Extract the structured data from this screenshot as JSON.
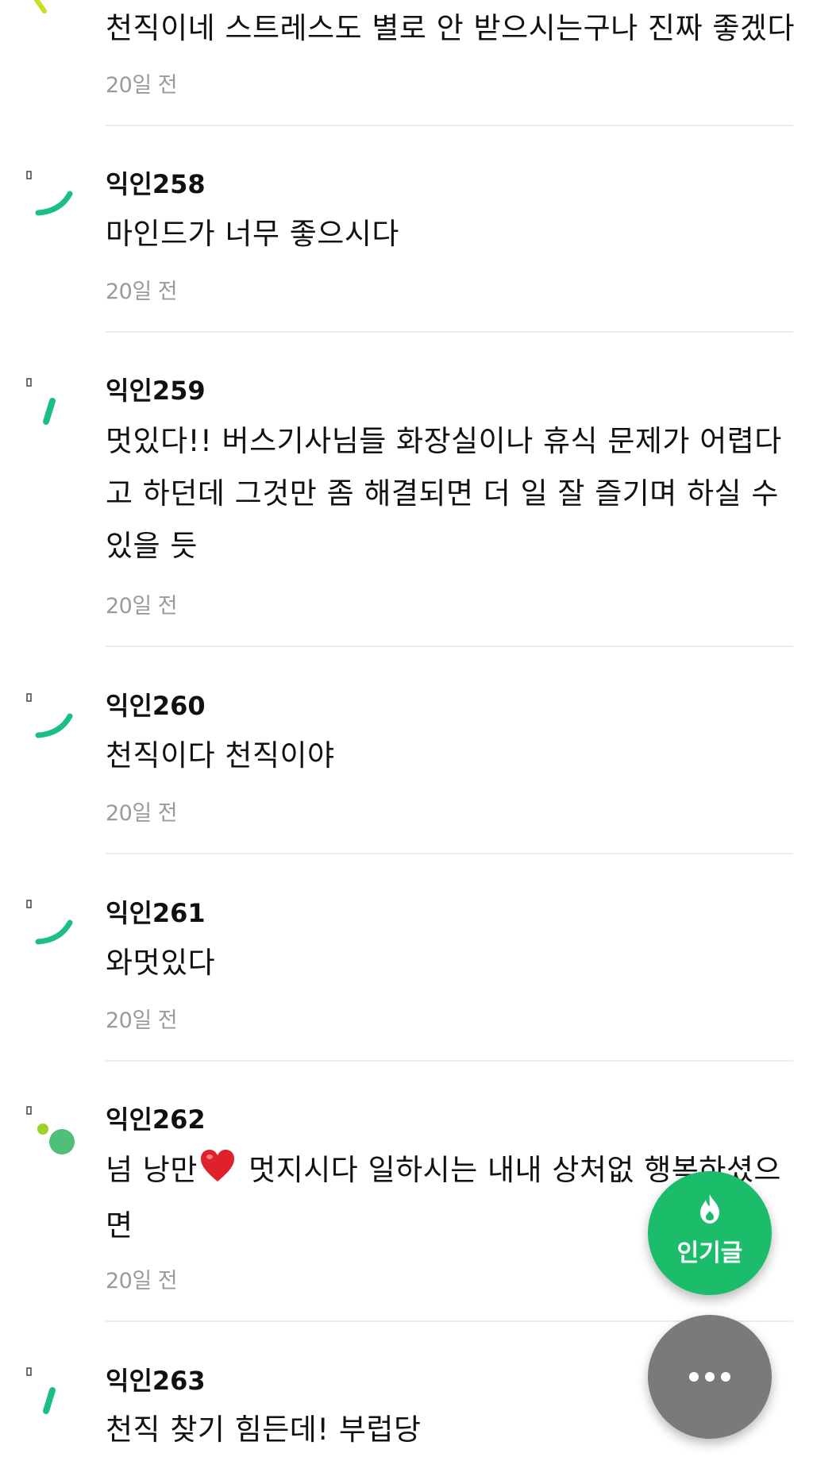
{
  "comments": [
    {
      "author": "",
      "content": "천직이네 스트레스도 별로 안 받으시는구나 진짜 좋겠다",
      "time": "20일 전"
    },
    {
      "author": "익인258",
      "content": "마인드가 너무 좋으시다",
      "time": "20일 전"
    },
    {
      "author": "익인259",
      "content": "멋있다!! 버스기사님들 화장실이나 휴식 문제가 어렵다고 하던데 그것만 좀 해결되면 더 일 잘 즐기며 하실 수 있을 듯",
      "time": "20일 전"
    },
    {
      "author": "익인260",
      "content": "천직이다 천직이야",
      "time": "20일 전"
    },
    {
      "author": "익인261",
      "content": "와멋있다",
      "time": "20일 전"
    },
    {
      "author": "익인262",
      "content_before": "넘 낭만",
      "content_after": " 멋지시다 일하시는 내내 상처없 행복하셨으면",
      "emoji": "heart-emoji",
      "time": "20일 전"
    },
    {
      "author": "익인263",
      "content": "천직 찾기 힘든데! 부럽당",
      "time": ""
    }
  ],
  "fab": {
    "popular_label": "인기글",
    "popular_icon": "flame-icon",
    "more_icon": "more-dots-icon"
  },
  "colors": {
    "accent_green": "#1bbd6a",
    "avatar_teal": "#1bbf86",
    "avatar_lime": "#c8dc28",
    "time_gray": "#9a9a9a",
    "divider": "#ececec",
    "fab_gray": "#7a7a7a"
  }
}
